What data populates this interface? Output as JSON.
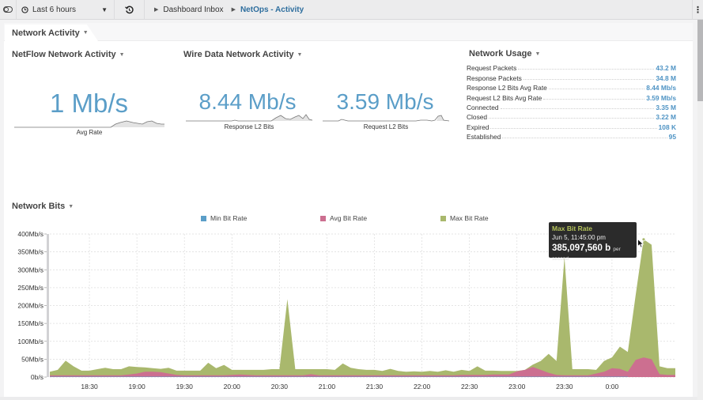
{
  "topbar": {
    "time_range": "Last 6 hours",
    "breadcrumbs": [
      "Dashboard Inbox",
      "NetOps - Activity"
    ]
  },
  "dashboard": {
    "tab_label": "Network Activity"
  },
  "netflow": {
    "title": "NetFlow Network Activity",
    "value": "1 Mb/s",
    "label": "Avg Rate"
  },
  "wiredata": {
    "title": "Wire Data Network Activity",
    "metrics": [
      {
        "value": "8.44 Mb/s",
        "label": "Response L2 Bits"
      },
      {
        "value": "3.59 Mb/s",
        "label": "Request L2 Bits"
      }
    ]
  },
  "usage": {
    "title": "Network Usage",
    "rows": [
      {
        "label": "Request Packets",
        "value": "43.2 M"
      },
      {
        "label": "Response Packets",
        "value": "34.8 M"
      },
      {
        "label": "Response L2 Bits Avg Rate",
        "value": "8.44 Mb/s"
      },
      {
        "label": "Request L2 Bits Avg Rate",
        "value": "3.59 Mb/s"
      },
      {
        "label": "Connected",
        "value": "3.35 M"
      },
      {
        "label": "Closed",
        "value": "3.22 M"
      },
      {
        "label": "Expired",
        "value": "108 K"
      },
      {
        "label": "Established",
        "value": "95"
      }
    ]
  },
  "bits": {
    "title": "Network Bits",
    "tooltip": {
      "series": "Max Bit Rate",
      "time": "Jun 5, 11:45:00 pm",
      "value": "385,097,560 b",
      "unit": "per second"
    }
  },
  "colors": {
    "min": "#5b9ec8",
    "avg": "#cc6f90",
    "max": "#a9b86d",
    "value_text": "#5b9ec8",
    "link_active": "#2e6e9e"
  },
  "chart_data": {
    "type": "area",
    "title": "Network Bits",
    "xlabel": "",
    "ylabel": "",
    "ylim": [
      0,
      400
    ],
    "y_unit": "Mb/s",
    "yticks": [
      "0b/s",
      "50Mb/s",
      "100Mb/s",
      "150Mb/s",
      "200Mb/s",
      "250Mb/s",
      "300Mb/s",
      "350Mb/s",
      "400Mb/s"
    ],
    "xticks": [
      "18:30",
      "19:00",
      "19:30",
      "20:00",
      "20:30",
      "21:00",
      "21:30",
      "22:00",
      "22:30",
      "23:00",
      "23:30",
      "0:00"
    ],
    "x_minutes": [
      0,
      5,
      10,
      15,
      20,
      25,
      30,
      35,
      40,
      45,
      50,
      55,
      60,
      65,
      70,
      75,
      80,
      85,
      90,
      95,
      100,
      105,
      110,
      115,
      120,
      125,
      130,
      135,
      140,
      145,
      150,
      155,
      160,
      165,
      170,
      175,
      180,
      185,
      190,
      195,
      200,
      205,
      210,
      215,
      220,
      225,
      230,
      235,
      240,
      245,
      250,
      255,
      260,
      265,
      270,
      275,
      280,
      285,
      290,
      295,
      300,
      305,
      310,
      315,
      320,
      325,
      330,
      335,
      340,
      345,
      350,
      355,
      360,
      365
    ],
    "x_start": "18:05",
    "legend": [
      "Min Bit Rate",
      "Avg Bit Rate",
      "Max Bit Rate"
    ],
    "legend_position": "top",
    "grid": true,
    "series": [
      {
        "name": "Min Bit Rate",
        "values": [
          1,
          1,
          1,
          1,
          1,
          1,
          1,
          1,
          1,
          1,
          1,
          1,
          1,
          1,
          1,
          1,
          1,
          1,
          1,
          1,
          1,
          1,
          1,
          1,
          1,
          1,
          1,
          1,
          1,
          1,
          1,
          1,
          1,
          1,
          1,
          1,
          1,
          1,
          1,
          1,
          1,
          1,
          1,
          1,
          1,
          1,
          1,
          1,
          1,
          1,
          1,
          1,
          1,
          1,
          1,
          1,
          1,
          1,
          1,
          1,
          1,
          1,
          1,
          1,
          1,
          1,
          1,
          1,
          1,
          1,
          1,
          1,
          1,
          1
        ]
      },
      {
        "name": "Avg Bit Rate",
        "values": [
          5,
          5,
          5,
          5,
          5,
          5,
          5,
          5,
          5,
          5,
          7,
          10,
          15,
          15,
          14,
          10,
          6,
          5,
          5,
          5,
          5,
          5,
          5,
          6,
          7,
          6,
          5,
          5,
          5,
          5,
          5,
          5,
          5,
          8,
          5,
          5,
          5,
          5,
          5,
          5,
          5,
          5,
          5,
          5,
          5,
          5,
          5,
          5,
          5,
          5,
          5,
          5,
          6,
          6,
          6,
          6,
          7,
          7,
          7,
          16,
          20,
          28,
          20,
          12,
          6,
          5,
          5,
          5,
          5,
          10,
          15,
          25,
          23,
          15,
          48,
          55,
          50,
          8,
          6,
          6
        ]
      },
      {
        "name": "Max Bit Rate",
        "values": [
          15,
          20,
          46,
          30,
          18,
          18,
          22,
          26,
          22,
          22,
          30,
          28,
          27,
          25,
          23,
          26,
          18,
          18,
          18,
          18,
          40,
          25,
          34,
          20,
          20,
          20,
          20,
          20,
          22,
          22,
          218,
          22,
          22,
          22,
          22,
          22,
          20,
          38,
          26,
          22,
          20,
          20,
          17,
          23,
          17,
          15,
          16,
          15,
          17,
          15,
          19,
          15,
          20,
          17,
          30,
          18,
          18,
          17,
          17,
          17,
          20,
          35,
          45,
          65,
          45,
          335,
          22,
          22,
          22,
          20,
          45,
          55,
          85,
          70,
          230,
          385,
          370,
          30,
          25,
          25
        ]
      }
    ]
  }
}
